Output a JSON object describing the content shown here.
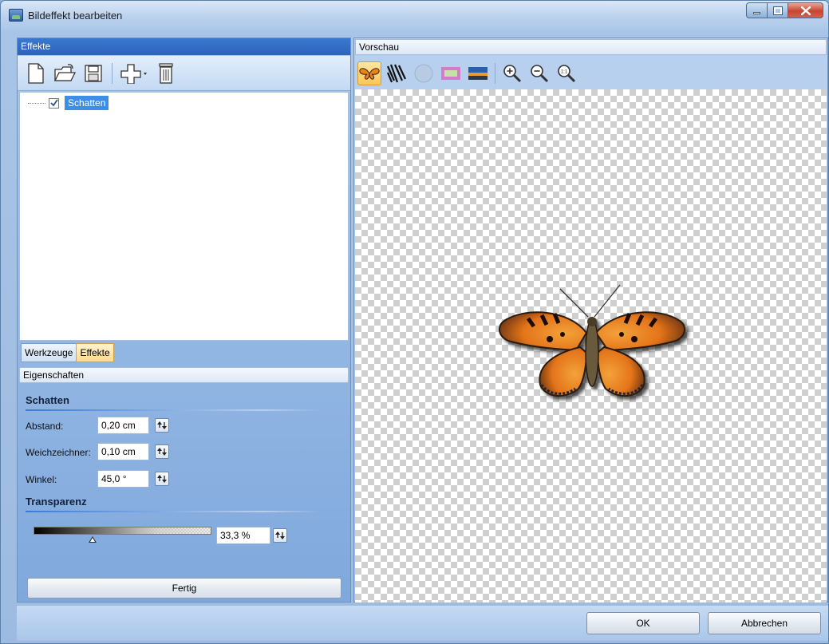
{
  "window": {
    "title": "Bildeffekt bearbeiten"
  },
  "left": {
    "header": "Effekte",
    "toolbar": [
      "new-document-icon",
      "open-folder-icon",
      "save-icon",
      "add-effect-icon",
      "delete-icon"
    ],
    "tree": {
      "items": [
        {
          "label": "Schatten",
          "checked": true
        }
      ]
    },
    "tabs": [
      {
        "label": "Werkzeuge",
        "active": false
      },
      {
        "label": "Effekte",
        "active": true
      }
    ],
    "properties_header": "Eigenschaften",
    "shadow": {
      "title": "Schatten",
      "fields": [
        {
          "label": "Abstand:",
          "value": "0,20 cm"
        },
        {
          "label": "Weichzeichner:",
          "value": "0,10 cm"
        },
        {
          "label": "Winkel:",
          "value": "45,0 °"
        }
      ]
    },
    "transparency": {
      "title": "Transparenz",
      "value": "33,3 %",
      "level": 0.333
    },
    "done_button": "Fertig"
  },
  "preview": {
    "header": "Vorschau",
    "toolbar": [
      "butterfly-image-icon",
      "zebra-pattern-icon",
      "circle-shape-icon",
      "frame-icon",
      "landscape-icon",
      "zoom-in-icon",
      "zoom-out-icon",
      "zoom-actual-size-icon"
    ],
    "zoom_actual_label": "1:1"
  },
  "footer": {
    "ok": "OK",
    "cancel": "Abbrechen"
  },
  "colors": {
    "accent": "#2d63b8",
    "selection": "#3d8ee6",
    "active_tab": "#ffd98a"
  }
}
